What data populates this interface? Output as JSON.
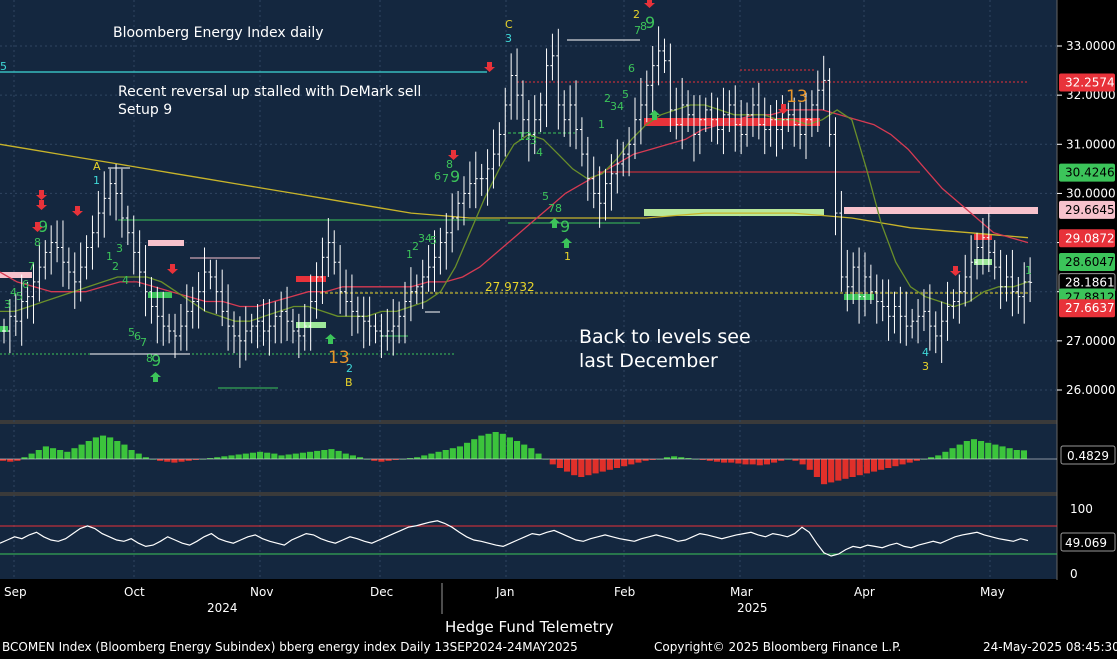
{
  "chart_data": {
    "type": "candlestick",
    "title": "Bloomberg Energy Index daily",
    "annotations": {
      "comment": "Recent reversal up stalled with DeMark sell",
      "comment_line2": "Setup 9",
      "back_levels_line1": "Back to levels see",
      "back_levels_line2": "last December",
      "level_label": "27.9732",
      "left_edge_label": "5",
      "A": "A",
      "B": "B",
      "C": "C",
      "count_13": "13",
      "count_9": "9"
    },
    "price_axis": {
      "ylim": [
        25.4,
        33.55
      ],
      "ticks": [
        "26.0000",
        "27.0000",
        "28.0000",
        "29.0000",
        "30.0000",
        "31.0000",
        "32.0000",
        "33.0000"
      ],
      "tick_values": [
        26,
        27,
        28,
        29,
        30,
        31,
        32,
        33
      ],
      "last_labels": [
        {
          "text": "32.2574",
          "value": 32.2574,
          "color": "#e8323a"
        },
        {
          "text": "30.4246",
          "value": 30.4246,
          "color": "#3cc45a"
        },
        {
          "text": "29.6645",
          "value": 29.6645,
          "color": "#f7c2cc"
        },
        {
          "text": "29.0872",
          "value": 29.0872,
          "color": "#e8323a"
        },
        {
          "text": "28.6047",
          "value": 28.6047,
          "color": "#3cc45a"
        },
        {
          "text": "28.1861",
          "value": 28.1861,
          "color": "#ffffff"
        },
        {
          "text": "27.8812",
          "value": 27.8812,
          "color": "#3cc45a"
        },
        {
          "text": "27.6637",
          "value": 27.6637,
          "color": "#e8323a"
        }
      ]
    },
    "macd_panel": {
      "last_value": "0.4829",
      "values": [
        -0.1,
        -0.15,
        -0.1,
        0.1,
        0.3,
        0.5,
        0.7,
        0.6,
        0.5,
        0.4,
        0.6,
        0.8,
        1.0,
        1.2,
        1.3,
        1.2,
        1.0,
        0.8,
        0.5,
        0.3,
        0.1,
        0.0,
        -0.1,
        -0.15,
        -0.2,
        -0.15,
        -0.1,
        -0.05,
        0.0,
        0.05,
        0.1,
        0.15,
        0.2,
        0.25,
        0.3,
        0.35,
        0.4,
        0.35,
        0.3,
        0.2,
        0.25,
        0.3,
        0.35,
        0.4,
        0.45,
        0.5,
        0.55,
        0.45,
        0.3,
        0.2,
        0.1,
        0.0,
        -0.1,
        -0.15,
        -0.1,
        -0.05,
        0.0,
        0.05,
        0.1,
        0.2,
        0.3,
        0.4,
        0.5,
        0.6,
        0.7,
        0.9,
        1.1,
        1.3,
        1.4,
        1.5,
        1.4,
        1.2,
        1.0,
        0.8,
        0.6,
        0.3,
        0.0,
        -0.3,
        -0.5,
        -0.7,
        -0.9,
        -1.0,
        -0.9,
        -0.8,
        -0.7,
        -0.6,
        -0.5,
        -0.4,
        -0.3,
        -0.2,
        -0.1,
        -0.05,
        0.0,
        0.1,
        0.15,
        0.1,
        0.05,
        0.0,
        -0.05,
        -0.1,
        -0.15,
        -0.2,
        -0.2,
        -0.25,
        -0.3,
        -0.3,
        -0.35,
        -0.3,
        -0.2,
        -0.1,
        0.0,
        -0.1,
        -0.3,
        -0.6,
        -1.0,
        -1.4,
        -1.3,
        -1.2,
        -1.1,
        -1.0,
        -0.9,
        -0.8,
        -0.7,
        -0.6,
        -0.5,
        -0.4,
        -0.3,
        -0.2,
        -0.1,
        0.0,
        0.1,
        0.2,
        0.4,
        0.6,
        0.8,
        1.0,
        1.1,
        1.0,
        0.9,
        0.8,
        0.7,
        0.6,
        0.5,
        0.48
      ]
    },
    "rsi_panel": {
      "ticks": [
        "100",
        "0"
      ],
      "last_value": "49.069",
      "overbought": 70,
      "oversold": 30,
      "values": [
        45,
        50,
        55,
        52,
        58,
        62,
        55,
        50,
        48,
        52,
        60,
        68,
        72,
        68,
        60,
        55,
        50,
        48,
        52,
        45,
        40,
        42,
        48,
        55,
        50,
        45,
        42,
        48,
        55,
        60,
        52,
        48,
        45,
        50,
        55,
        58,
        52,
        48,
        45,
        42,
        50,
        55,
        60,
        58,
        52,
        48,
        45,
        50,
        55,
        52,
        48,
        45,
        50,
        55,
        60,
        65,
        70,
        72,
        75,
        78,
        80,
        76,
        70,
        62,
        55,
        50,
        48,
        45,
        42,
        40,
        45,
        50,
        55,
        60,
        58,
        62,
        65,
        60,
        55,
        50,
        48,
        52,
        55,
        58,
        55,
        52,
        50,
        48,
        52,
        55,
        58,
        55,
        52,
        48,
        50,
        55,
        60,
        58,
        55,
        52,
        55,
        58,
        60,
        62,
        58,
        55,
        60,
        58,
        55,
        60,
        70,
        62,
        45,
        30,
        25,
        28,
        35,
        40,
        38,
        42,
        40,
        38,
        42,
        45,
        40,
        38,
        42,
        45,
        48,
        45,
        50,
        55,
        58,
        60,
        62,
        58,
        55,
        52,
        50,
        48,
        52,
        49
      ]
    },
    "time_axis": {
      "months": [
        "Sep",
        "Oct",
        "Nov",
        "Dec",
        "Jan",
        "Feb",
        "Mar",
        "Apr",
        "May"
      ],
      "years": [
        "2024",
        "2025"
      ]
    },
    "footer": {
      "center_title": "Hedge Fund Telemetry",
      "left": "BCOMEN Index (Bloomberg Energy Subindex) bberg energy index  Daily 13SEP2024-24MAY2025",
      "copyright": "Copyright© 2025 Bloomberg Finance L.P.",
      "timestamp": "24-May-2025 08:45:30"
    },
    "colors": {
      "background": "#14273f",
      "up": "#ffffff",
      "down": "#ffffff",
      "ma_short": "#6a8f2a",
      "ma_mid": "#d63a52",
      "ma_long": "#c8b42a",
      "macd_up": "#3cc43c",
      "macd_down": "#e0302a",
      "rsi_line": "#ffffff"
    },
    "series": [
      {
        "name": "price_close",
        "values": [
          27.2,
          27.5,
          27.4,
          27.8,
          27.9,
          28.2,
          28.5,
          28.8,
          29.0,
          28.9,
          28.6,
          28.4,
          28.2,
          28.5,
          28.9,
          29.2,
          29.6,
          29.9,
          30.2,
          30.0,
          29.5,
          29.2,
          28.8,
          28.4,
          28.0,
          27.7,
          27.5,
          27.3,
          27.2,
          27.1,
          27.3,
          27.6,
          27.8,
          28.0,
          28.4,
          28.3,
          28.0,
          27.6,
          27.3,
          27.1,
          27.0,
          27.2,
          27.3,
          27.4,
          27.2,
          27.3,
          27.5,
          27.6,
          27.4,
          27.2,
          27.1,
          27.3,
          27.8,
          28.3,
          28.7,
          29.0,
          28.6,
          28.0,
          27.8,
          27.6,
          27.5,
          27.4,
          27.3,
          27.2,
          27.1,
          27.2,
          27.3,
          27.5,
          27.8,
          28.0,
          28.1,
          28.3,
          28.5,
          28.7,
          29.0,
          29.2,
          29.5,
          29.8,
          30.0,
          30.2,
          30.3,
          30.3,
          30.5,
          30.8,
          31.2,
          31.8,
          32.4,
          32.0,
          31.5,
          31.2,
          31.5,
          31.8,
          32.6,
          32.8,
          31.8,
          31.5,
          31.8,
          31.3,
          30.8,
          30.3,
          30.0,
          29.8,
          30.2,
          30.4,
          30.6,
          30.8,
          31.0,
          31.5,
          31.8,
          32.2,
          32.6,
          32.9,
          32.7,
          31.7,
          31.4,
          31.8,
          31.6,
          31.2,
          31.5,
          31.7,
          31.5,
          31.3,
          31.6,
          31.8,
          31.4,
          31.2,
          31.6,
          31.8,
          31.4,
          31.3,
          31.5,
          31.3,
          31.5,
          31.6,
          31.4,
          31.2,
          31.5,
          31.8,
          32.1,
          32.3,
          31.2,
          29.6,
          28.3,
          28.1,
          28.5,
          27.9,
          28.3,
          28.0,
          27.8,
          27.7,
          27.5,
          27.7,
          27.5,
          27.3,
          27.4,
          27.5,
          27.6,
          27.3,
          27.1,
          27.4,
          27.7,
          27.8,
          28.0,
          28.3,
          28.6,
          28.9,
          29.1,
          28.8,
          28.5,
          28.1,
          28.3,
          28.0,
          27.9,
          28.2,
          28.19
        ]
      },
      {
        "name": "ma_short",
        "values": [
          27.6,
          27.6,
          27.7,
          27.8,
          27.9,
          28.0,
          28.1,
          28.2,
          28.3,
          28.3,
          28.3,
          28.2,
          28.0,
          27.8,
          27.6,
          27.5,
          27.4,
          27.4,
          27.5,
          27.6,
          27.7,
          27.7,
          27.6,
          27.5,
          27.5,
          27.5,
          27.6,
          27.6,
          27.7,
          27.8,
          28.0,
          28.5,
          29.2,
          29.9,
          30.5,
          31.0,
          31.2,
          31.1,
          30.8,
          30.5,
          30.3,
          30.4,
          30.7,
          31.1,
          31.4,
          31.6,
          31.7,
          31.8,
          31.8,
          31.7,
          31.6,
          31.6,
          31.6,
          31.5,
          31.5,
          31.4,
          31.5,
          31.7,
          31.5,
          30.5,
          29.4,
          28.6,
          28.1,
          27.9,
          27.8,
          27.7,
          27.8,
          28.0,
          28.1,
          28.1,
          28.2
        ]
      },
      {
        "name": "ma_mid",
        "values": [
          28.4,
          28.2,
          28.1,
          28.0,
          28.0,
          28.0,
          28.1,
          28.2,
          28.2,
          28.1,
          28.0,
          27.9,
          27.8,
          27.8,
          27.7,
          27.7,
          27.8,
          27.9,
          28.0,
          28.0,
          28.1,
          28.1,
          28.1,
          28.1,
          28.1,
          28.2,
          28.2,
          28.3,
          28.5,
          28.8,
          29.1,
          29.4,
          29.7,
          30.0,
          30.2,
          30.4,
          30.6,
          30.8,
          30.9,
          31.0,
          31.1,
          31.3,
          31.4,
          31.5,
          31.6,
          31.6,
          31.7,
          31.7,
          31.7,
          31.6,
          31.5,
          31.4,
          31.2,
          30.9,
          30.5,
          30.1,
          29.8,
          29.5,
          29.2,
          29.1,
          29.0
        ]
      },
      {
        "name": "ma_long",
        "values": [
          31.0,
          30.9,
          30.8,
          30.7,
          30.6,
          30.5,
          30.4,
          30.3,
          30.2,
          30.1,
          30.0,
          29.9,
          29.8,
          29.7,
          29.6,
          29.55,
          29.5,
          29.5,
          29.5,
          29.5,
          29.5,
          29.5,
          29.5,
          29.55,
          29.6,
          29.6,
          29.6,
          29.6,
          29.55,
          29.5,
          29.4,
          29.3,
          29.25,
          29.2,
          29.15,
          29.1
        ]
      }
    ]
  }
}
